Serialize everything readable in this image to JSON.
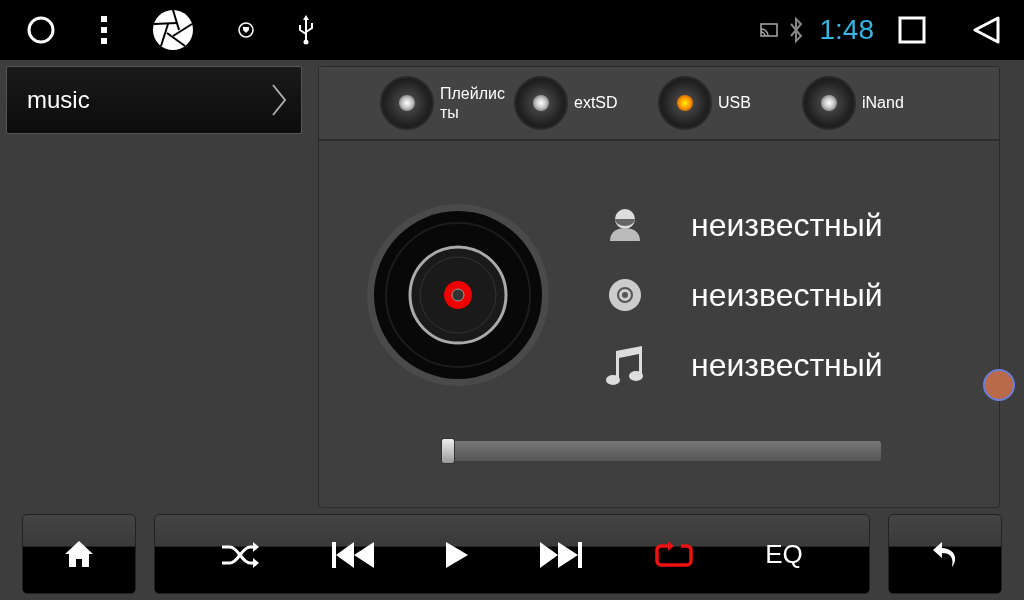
{
  "status_bar": {
    "time": "1:48"
  },
  "folder": {
    "label": "music"
  },
  "sources": [
    {
      "label": "Плейлисты",
      "selected": false
    },
    {
      "label": "extSD",
      "selected": false
    },
    {
      "label": "USB",
      "selected": true
    },
    {
      "label": "iNand",
      "selected": false
    }
  ],
  "track_info": [
    {
      "kind": "artist",
      "text": "неизвестный"
    },
    {
      "kind": "album",
      "text": "неизвестный"
    },
    {
      "kind": "title",
      "text": "неизвестный"
    }
  ],
  "progress": {
    "level": 0
  },
  "controls": [
    {
      "kind": "shuffle",
      "active": false
    },
    {
      "kind": "previous"
    },
    {
      "kind": "play"
    },
    {
      "kind": "next"
    },
    {
      "kind": "repeat",
      "active": true
    },
    {
      "kind": "eq",
      "label": "EQ"
    }
  ]
}
